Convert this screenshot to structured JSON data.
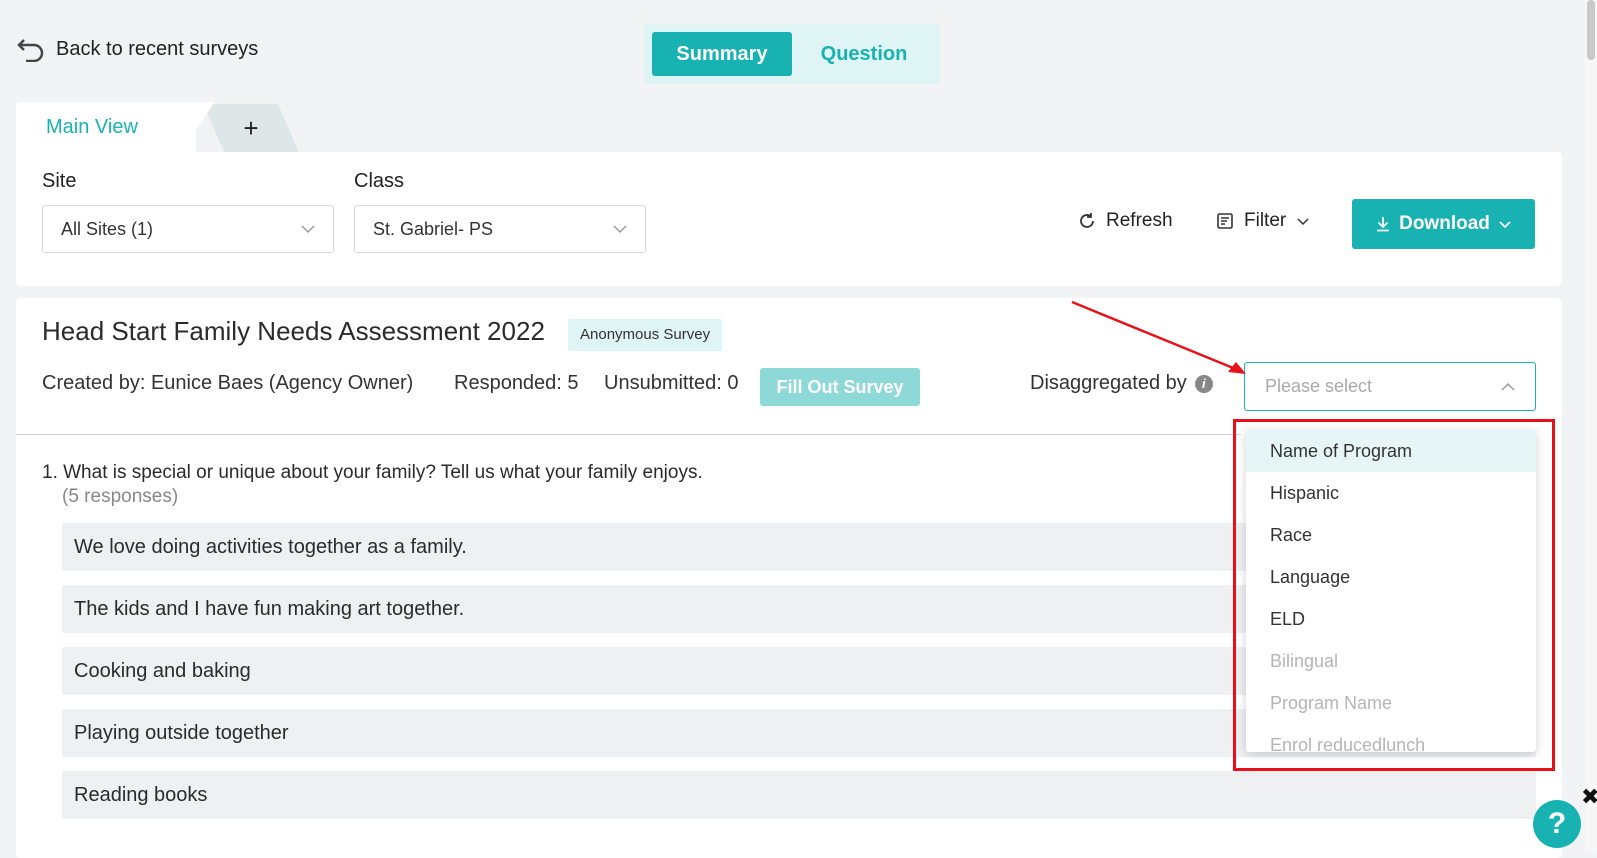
{
  "header": {
    "back_label": "Back to recent surveys",
    "toggle": {
      "summary": "Summary",
      "question": "Question"
    }
  },
  "tabs": {
    "main": "Main View",
    "add": "+"
  },
  "filters": {
    "site_label": "Site",
    "site_value": "All Sites (1)",
    "class_label": "Class",
    "class_value": "St. Gabriel- PS",
    "refresh": "Refresh",
    "filter": "Filter",
    "download": "Download"
  },
  "survey": {
    "title": "Head Start Family Needs Assessment 2022",
    "badge": "Anonymous Survey",
    "created_by": "Created by: Eunice Baes (Agency Owner)",
    "responded": "Responded: 5",
    "unsubmitted": "Unsubmitted: 0",
    "fill_out": "Fill Out Survey",
    "disaggregated_label": "Disaggregated by",
    "disaggregated_placeholder": "Please select"
  },
  "question": {
    "text": "1. What is special or unique about your family? Tell us what your family enjoys.",
    "count": "(5 responses)",
    "responses": [
      "We love doing activities together as a family.",
      "The kids and I have fun making art together.",
      "Cooking and baking",
      "Playing outside together",
      "Reading books"
    ]
  },
  "dropdown": {
    "options": [
      {
        "label": "Name of Program",
        "state": "highlighted"
      },
      {
        "label": "Hispanic",
        "state": "enabled"
      },
      {
        "label": "Race",
        "state": "enabled"
      },
      {
        "label": "Language",
        "state": "enabled"
      },
      {
        "label": "ELD",
        "state": "enabled"
      },
      {
        "label": "Bilingual",
        "state": "disabled"
      },
      {
        "label": "Program Name",
        "state": "disabled"
      },
      {
        "label": "Enrol reducedlunch",
        "state": "disabled"
      }
    ]
  },
  "help": {
    "label": "?",
    "close": "✖"
  },
  "colors": {
    "accent": "#19b2b2",
    "annotation": "#e8111b"
  }
}
